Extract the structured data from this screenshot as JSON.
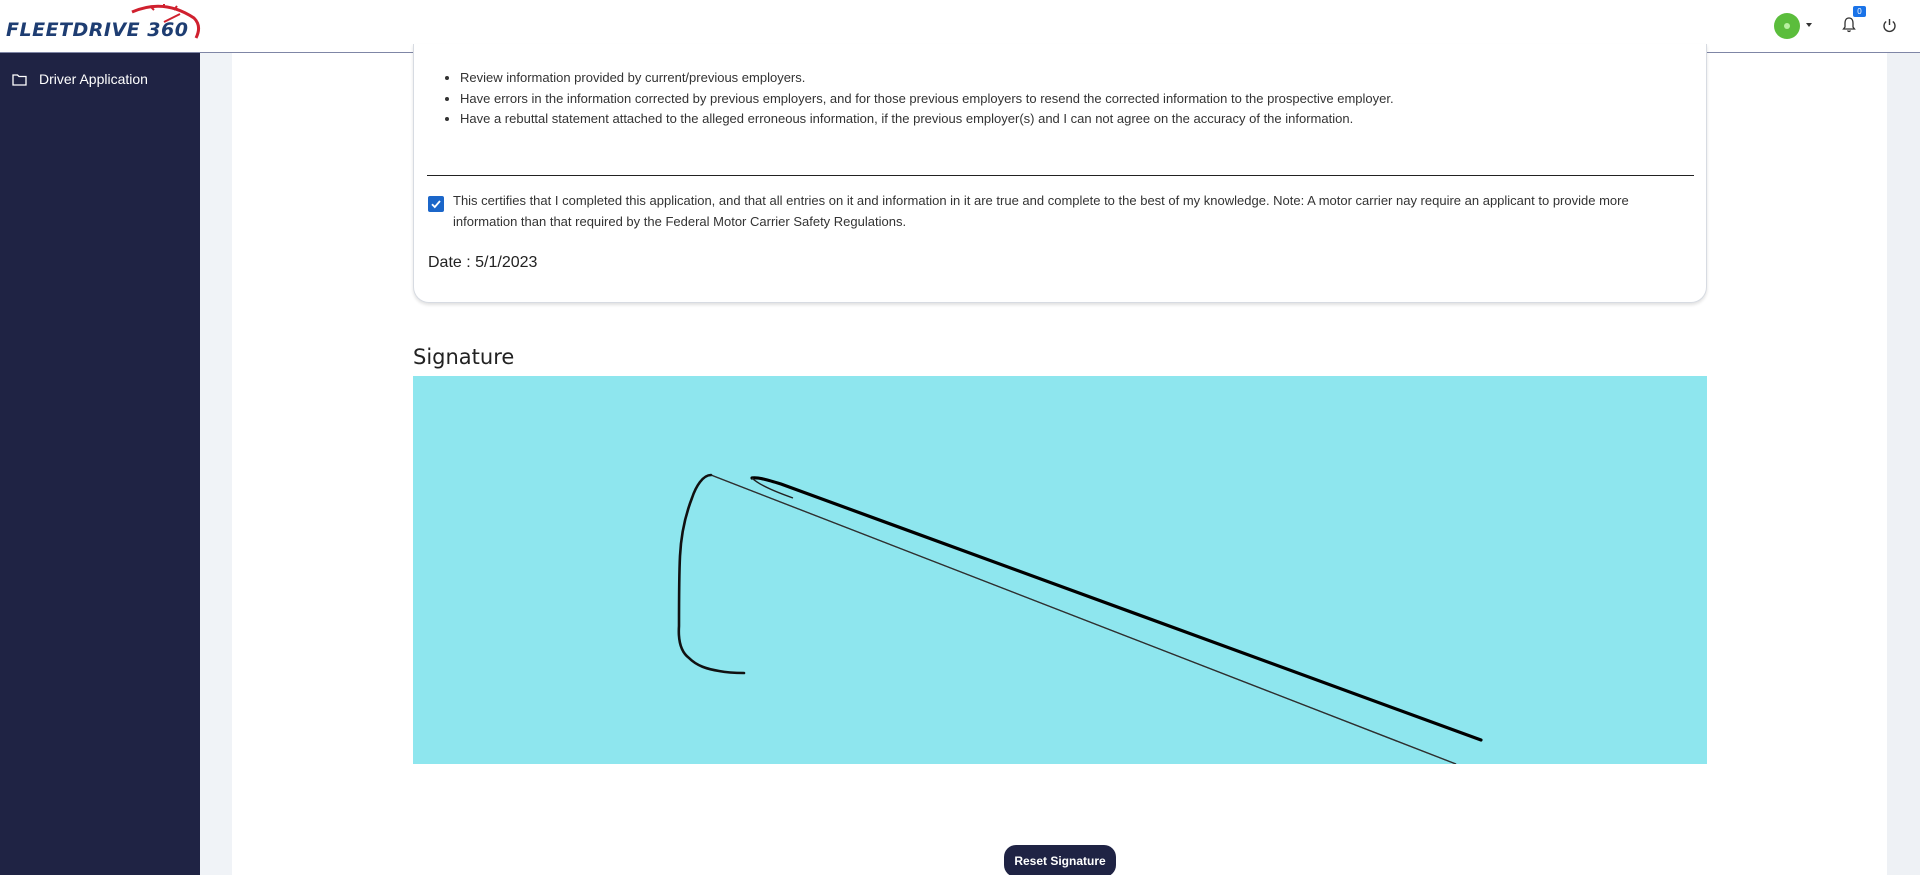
{
  "app": {
    "logo_text": "FLEETDRIVE 360"
  },
  "header": {
    "notification_count": "0"
  },
  "sidebar": {
    "items": [
      {
        "label": "Driver Application",
        "icon": "folder-icon"
      }
    ]
  },
  "rights": {
    "items": [
      "Review information provided by current/previous employers.",
      "Have errors in the information corrected by previous employers, and for those previous employers to resend the corrected information to the prospective employer.",
      "Have a rebuttal statement attached to the alleged erroneous information, if the previous employer(s) and I can not agree on the accuracy of the information."
    ]
  },
  "certification": {
    "checked": true,
    "text": "This certifies that I completed this application, and that all entries on it and information in it are true and complete to the best of my knowledge. Note: A motor carrier nay require an applicant to provide more information than that required by the Federal Motor Carrier Safety Regulations."
  },
  "date": {
    "label": "Date : 5/1/2023"
  },
  "signature": {
    "title": "Signature",
    "pad_color": "#8ee6ee",
    "reset_label": "Reset Signature"
  },
  "colors": {
    "sidebar": "#1f2344",
    "checkbox": "#1b66c9",
    "logo_red": "#d0202e",
    "logo_blue": "#1e3d72"
  }
}
